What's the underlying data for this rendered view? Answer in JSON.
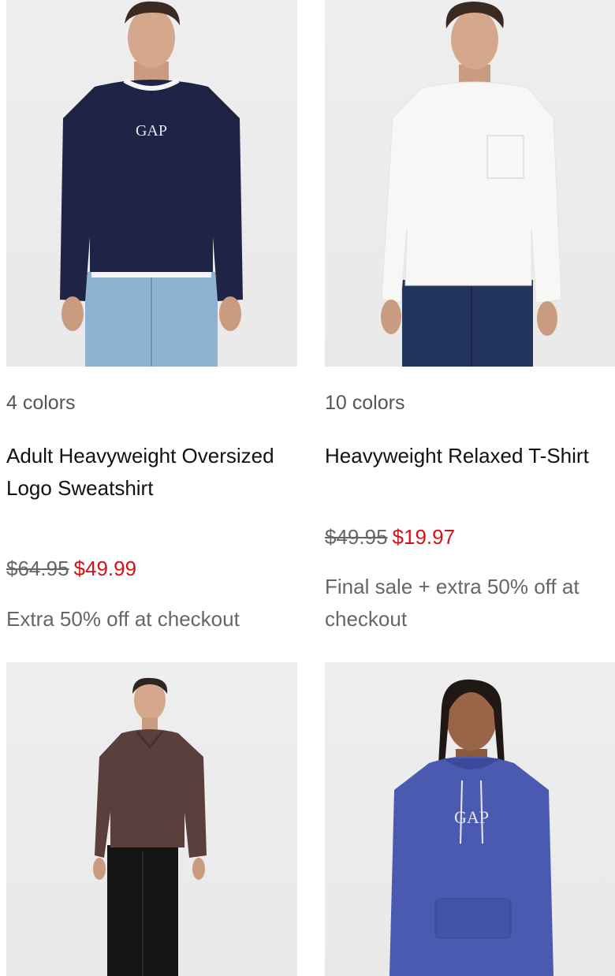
{
  "products": [
    {
      "colors": "4 colors",
      "title": "Adult Heavyweight Oversized Logo Sweatshirt",
      "original_price": "$64.95",
      "sale_price": "$49.99",
      "promo": "Extra 50% off at checkout",
      "logo": "GAP"
    },
    {
      "colors": "10 colors",
      "title": "Heavyweight Relaxed T-Shirt",
      "original_price": "$49.95",
      "sale_price": "$19.97",
      "promo": "Final sale + extra 50% off at checkout"
    },
    {
      "image": "brown-polo-sweatshirt"
    },
    {
      "image": "blue-logo-hoodie",
      "logo": "GAP"
    }
  ],
  "colors": {
    "sale": "#d51217",
    "muted_text": "#666666",
    "image_bg": "#eeeeee"
  }
}
